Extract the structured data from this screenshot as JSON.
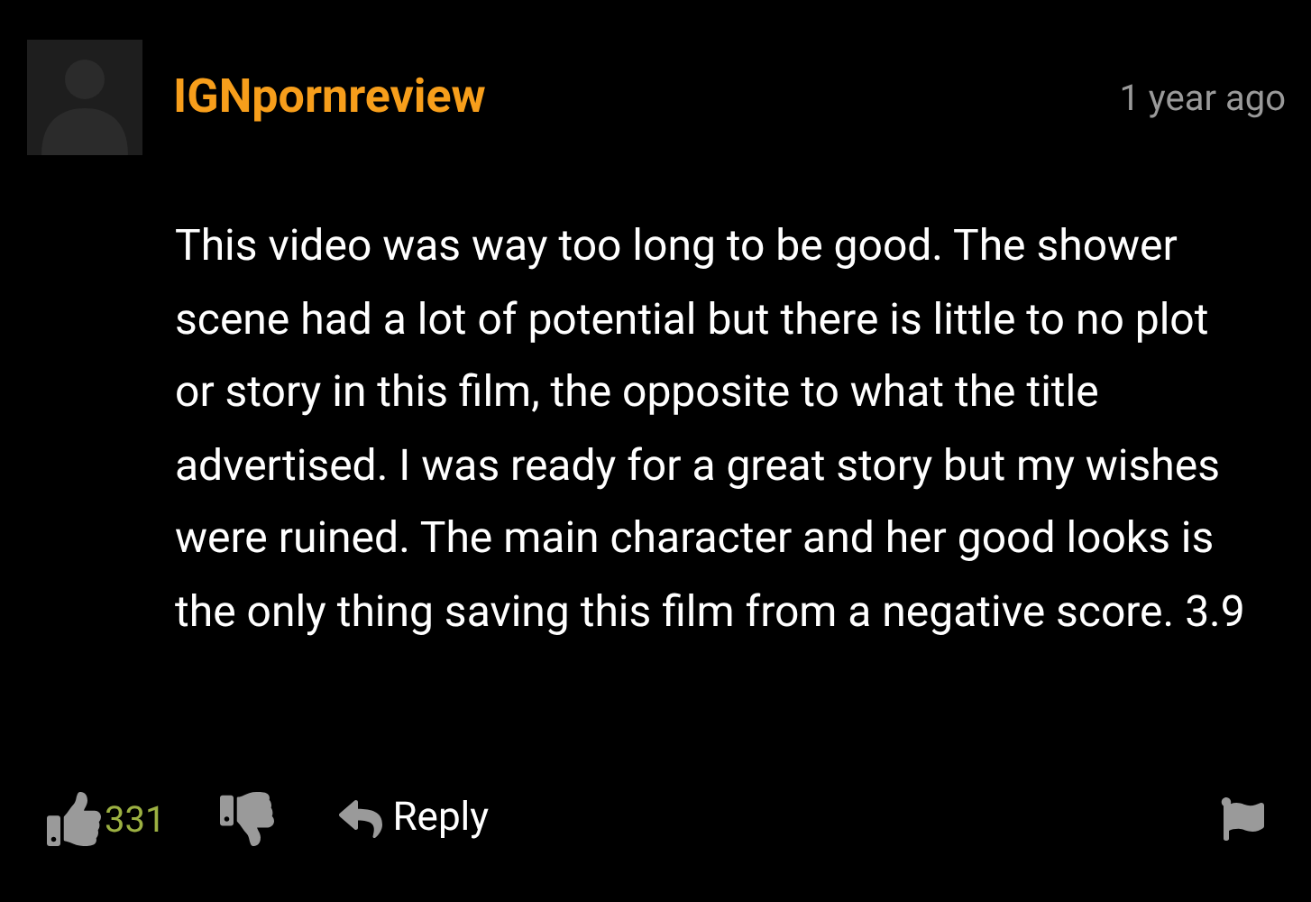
{
  "comment": {
    "author": "IGNpornreview",
    "time": "1 year ago",
    "body": "This video was way too long to be good. The shower scene had a lot of potential but there is little to no plot or story in this film, the opposite to what the title advertised. I was ready for a great story but my wishes were ruined. The main character and her good looks is the only thing saving this film from a negative score. 3.9",
    "likes": "331",
    "reply_label": "Reply"
  }
}
